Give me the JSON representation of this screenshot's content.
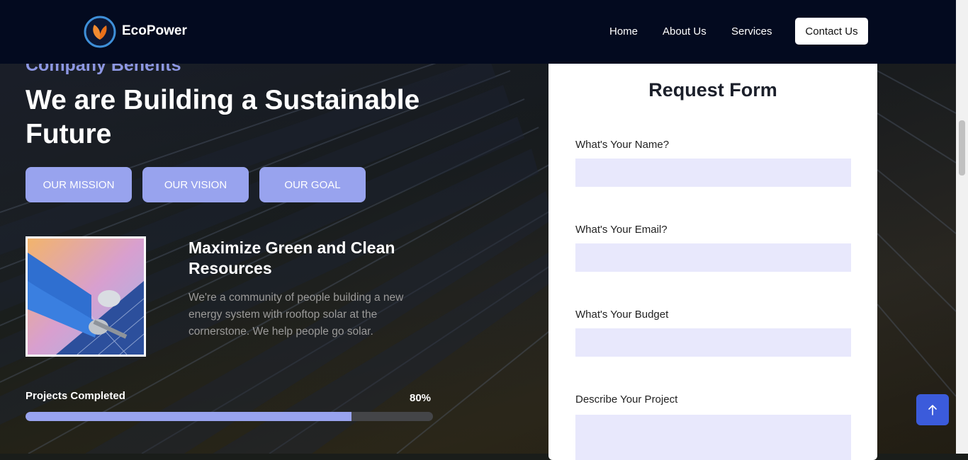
{
  "header": {
    "brand": "EcoPower",
    "nav": [
      "Home",
      "About Us",
      "Services"
    ],
    "contact_label": "Contact Us"
  },
  "hero": {
    "eyebrow": "Company Benefits",
    "headline": "We are Building a Sustainable Future",
    "tabs": [
      "OUR MISSION",
      "OUR VISION",
      "OUR GOAL"
    ]
  },
  "feature": {
    "title": "Maximize Green and Clean Resources",
    "text": "We're a community of people building a new energy system with rooftop solar at the cornerstone. We help people go solar."
  },
  "progress": {
    "label": "Projects Completed",
    "value_text": "80%",
    "value": 0.8
  },
  "form": {
    "title": "Request Form",
    "fields": [
      {
        "label": "What's Your Name?",
        "value": ""
      },
      {
        "label": "What's Your Email?",
        "value": ""
      },
      {
        "label": "What's Your Budget",
        "value": ""
      },
      {
        "label": "Describe Your Project",
        "value": ""
      }
    ]
  },
  "colors": {
    "header_bg": "#030a1f",
    "accent": "#98a3ee",
    "input_bg": "#e8e8fc",
    "to_top_bg": "#3b5bdb"
  },
  "icons": {
    "logo": "leaf-logo-icon",
    "to_top": "arrow-up-icon"
  }
}
